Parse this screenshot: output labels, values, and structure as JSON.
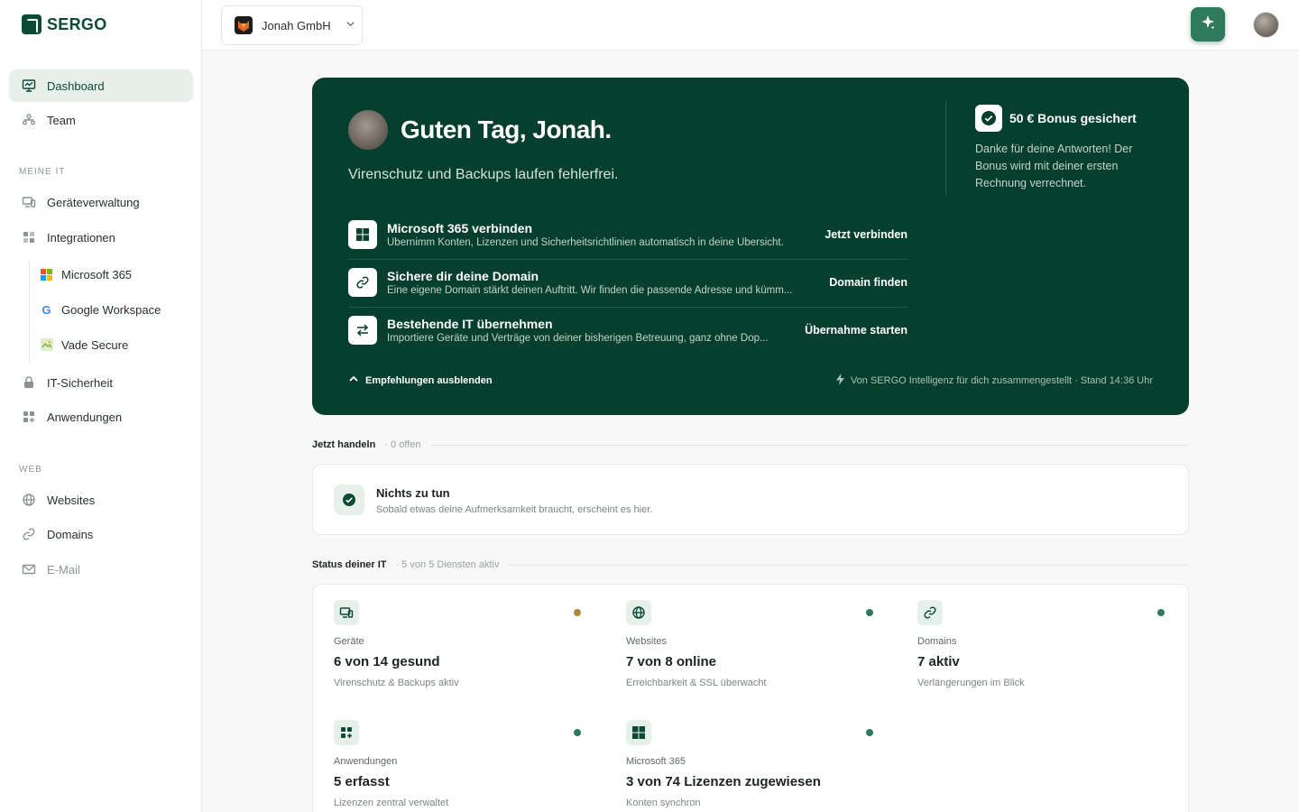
{
  "brand": {
    "name": "SERGO",
    "color": "#0b4a35"
  },
  "sidebar": {
    "top_items": [
      {
        "label": "Dashboard",
        "icon": "monitor-chart-icon",
        "active": true
      },
      {
        "label": "Team",
        "icon": "team-icon",
        "active": false
      }
    ],
    "section_meine_it": "MEINE IT",
    "meine_it_items": [
      {
        "label": "Geräteverwaltung",
        "icon": "devices-icon"
      },
      {
        "label": "Integrationen",
        "icon": "puzzle-icon"
      }
    ],
    "integration_items": [
      {
        "label": "Microsoft 365",
        "icon": "microsoft-logo-icon"
      },
      {
        "label": "Google Workspace",
        "icon": "google-logo-icon"
      },
      {
        "label": "Vade Secure",
        "icon": "vade-logo-icon"
      }
    ],
    "security_items": [
      {
        "label": "IT-Sicherheit",
        "icon": "lock-icon"
      },
      {
        "label": "Anwendungen",
        "icon": "apps-icon"
      }
    ],
    "section_web": "WEB",
    "web_items": [
      {
        "label": "Websites",
        "icon": "globe-icon"
      },
      {
        "label": "Domains",
        "icon": "link-icon"
      },
      {
        "label": "E-Mail",
        "icon": "mail-icon"
      }
    ]
  },
  "topbar": {
    "org_name": "Jonah GmbH",
    "ai_button_icon": "sparkle-icon",
    "user_avatar": "avatar"
  },
  "hero": {
    "greeting": "Guten Tag, Jonah.",
    "subtitle": "Virenschutz und Backups laufen fehlerfrei.",
    "recommendations": [
      {
        "title": "Microsoft 365 verbinden",
        "description": "Übernimm Konten, Lizenzen und Sicherheitsrichtlinien automatisch in deine Übersicht.",
        "action": "Jetzt verbinden",
        "icon": "windows-grid-icon"
      },
      {
        "title": "Sichere dir deine Domain",
        "description": "Eine eigene Domain stärkt deinen Auftritt. Wir finden die passende Adresse und kümm...",
        "action": "Domain finden",
        "icon": "link-icon"
      },
      {
        "title": "Bestehende IT übernehmen",
        "description": "Importiere Geräte und Verträge von deiner bisherigen Betreuung, ganz ohne Dop...",
        "action": "Übernahme starten",
        "icon": "transfer-arrows-icon"
      }
    ],
    "hide_label": "Empfehlungen ausblenden",
    "footer_note": "Von SERGO Intelligenz für dich zusammengestellt · Stand 14:36 Uhr",
    "bonus_title": "50 € Bonus gesichert",
    "bonus_text": "Danke für deine Antworten! Der Bonus wird mit deiner ersten Rechnung verrechnet."
  },
  "jetzt_handeln": {
    "title": "Jetzt handeln",
    "meta": "· 0 offen",
    "empty_title": "Nichts zu tun",
    "empty_desc": "Sobald etwas deine Aufmerksamkeit braucht, erscheint es hier."
  },
  "status": {
    "title": "Status deiner IT",
    "meta": "· 5 von 5 Diensten aktiv",
    "tiles": [
      {
        "label": "Geräte",
        "value": "6 von 14 gesund",
        "desc": "Virenschutz & Backups aktiv",
        "icon": "devices-icon",
        "dot_color": "#b0873a"
      },
      {
        "label": "Websites",
        "value": "7 von 8 online",
        "desc": "Erreichbarkeit & SSL überwacht",
        "icon": "globe-icon",
        "dot_color": "#2f7a5c"
      },
      {
        "label": "Domains",
        "value": "7 aktiv",
        "desc": "Verlängerungen im Blick",
        "icon": "link-icon",
        "dot_color": "#2f7a5c"
      },
      {
        "label": "Anwendungen",
        "value": "5 erfasst",
        "desc": "Lizenzen zentral verwaltet",
        "icon": "apps-icon",
        "dot_color": "#2f7a5c"
      },
      {
        "label": "Microsoft 365",
        "value": "3 von 74 Lizenzen zugewiesen",
        "desc": "Konten synchron",
        "icon": "windows-grid-icon",
        "dot_color": "#2f7a5c"
      }
    ]
  }
}
